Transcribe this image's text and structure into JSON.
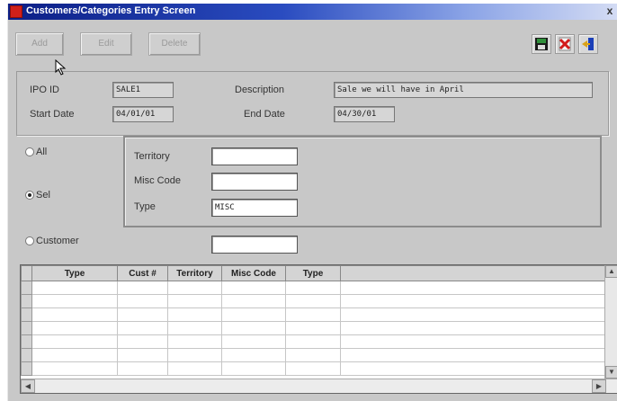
{
  "window": {
    "title": "Customers/Categories Entry Screen",
    "close": "x"
  },
  "toolbar": {
    "add_label": "Add",
    "edit_label": "Edit",
    "delete_label": "Delete"
  },
  "header": {
    "ipo_id_label": "IPO ID",
    "ipo_id_value": "SALE1",
    "description_label": "Description",
    "description_value": "Sale we will have in April",
    "start_date_label": "Start Date",
    "start_date_value": "04/01/01",
    "end_date_label": "End Date",
    "end_date_value": "04/30/01"
  },
  "filter": {
    "radios": {
      "all": "All",
      "sel": "Sel",
      "customer": "Customer"
    },
    "selected": "sel",
    "territory_label": "Territory",
    "territory_value": "",
    "misc_code_label": "Misc Code",
    "misc_code_value": "",
    "type_label": "Type",
    "type_value": "MISC",
    "customer_value": ""
  },
  "grid": {
    "columns": [
      "Type",
      "Cust #",
      "Territory",
      "Misc Code",
      "Type"
    ],
    "row_count": 7
  },
  "icons": [
    "save-icon",
    "cancel-icon",
    "exit-icon"
  ]
}
